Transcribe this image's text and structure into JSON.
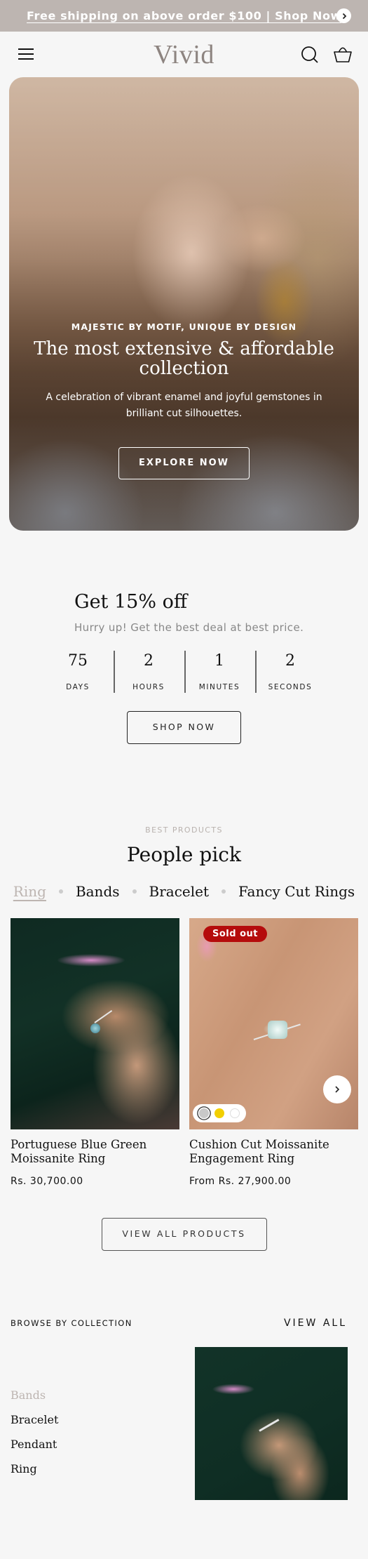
{
  "announcement": {
    "text": "Free shipping on above order $100 | Shop Now",
    "next_icon": "chevron-right-icon"
  },
  "header": {
    "logo": "Vivid",
    "menu_icon": "hamburger-icon",
    "search_icon": "search-icon",
    "cart_icon": "basket-icon"
  },
  "hero": {
    "kicker": "MAJESTIC BY MOTIF, UNIQUE BY DESIGN",
    "title": "The most extensive & affordable collection",
    "description": "A celebration of vibrant enamel and joyful gemstones in brilliant cut silhouettes.",
    "button": "EXPLORE NOW"
  },
  "promo": {
    "title": "Get 15% off",
    "subtitle": "Hurry up! Get the best deal at best price.",
    "countdown": [
      {
        "value": "75",
        "label": "DAYS"
      },
      {
        "value": "2",
        "label": "HOURS"
      },
      {
        "value": "1",
        "label": "MINUTES"
      },
      {
        "value": "2",
        "label": "SECONDS"
      }
    ],
    "button": "SHOP NOW"
  },
  "best_products": {
    "kicker": "BEST PRODUCTS",
    "title": "People pick",
    "tabs": [
      {
        "label": "Ring",
        "active": true
      },
      {
        "label": "Bands",
        "active": false
      },
      {
        "label": "Bracelet",
        "active": false
      },
      {
        "label": "Fancy Cut Rings",
        "active": false
      }
    ],
    "products": [
      {
        "name": "Portuguese Blue Green Moissanite Ring",
        "price": "Rs. 30,700.00"
      },
      {
        "name": "Cushion Cut Moissanite Engagement Ring",
        "price": "From Rs. 27,900.00",
        "badge": "Sold out",
        "swatches": [
          {
            "color": "#c8c8c8",
            "selected": true
          },
          {
            "color": "#f2cf00",
            "selected": false
          },
          {
            "color": "#ffffff",
            "selected": false
          }
        ]
      }
    ],
    "view_all": "VIEW ALL PRODUCTS"
  },
  "browse": {
    "title": "BROWSE BY COLLECTION",
    "view_all": "VIEW ALL",
    "collections": [
      {
        "label": "Bands",
        "active": true
      },
      {
        "label": "Bracelet",
        "active": false
      },
      {
        "label": "Pendant",
        "active": false
      },
      {
        "label": "Ring",
        "active": false
      }
    ]
  },
  "colors": {
    "accent": "#bdb5b1",
    "badge_red": "#b50c0c",
    "logo": "#8d8480"
  }
}
